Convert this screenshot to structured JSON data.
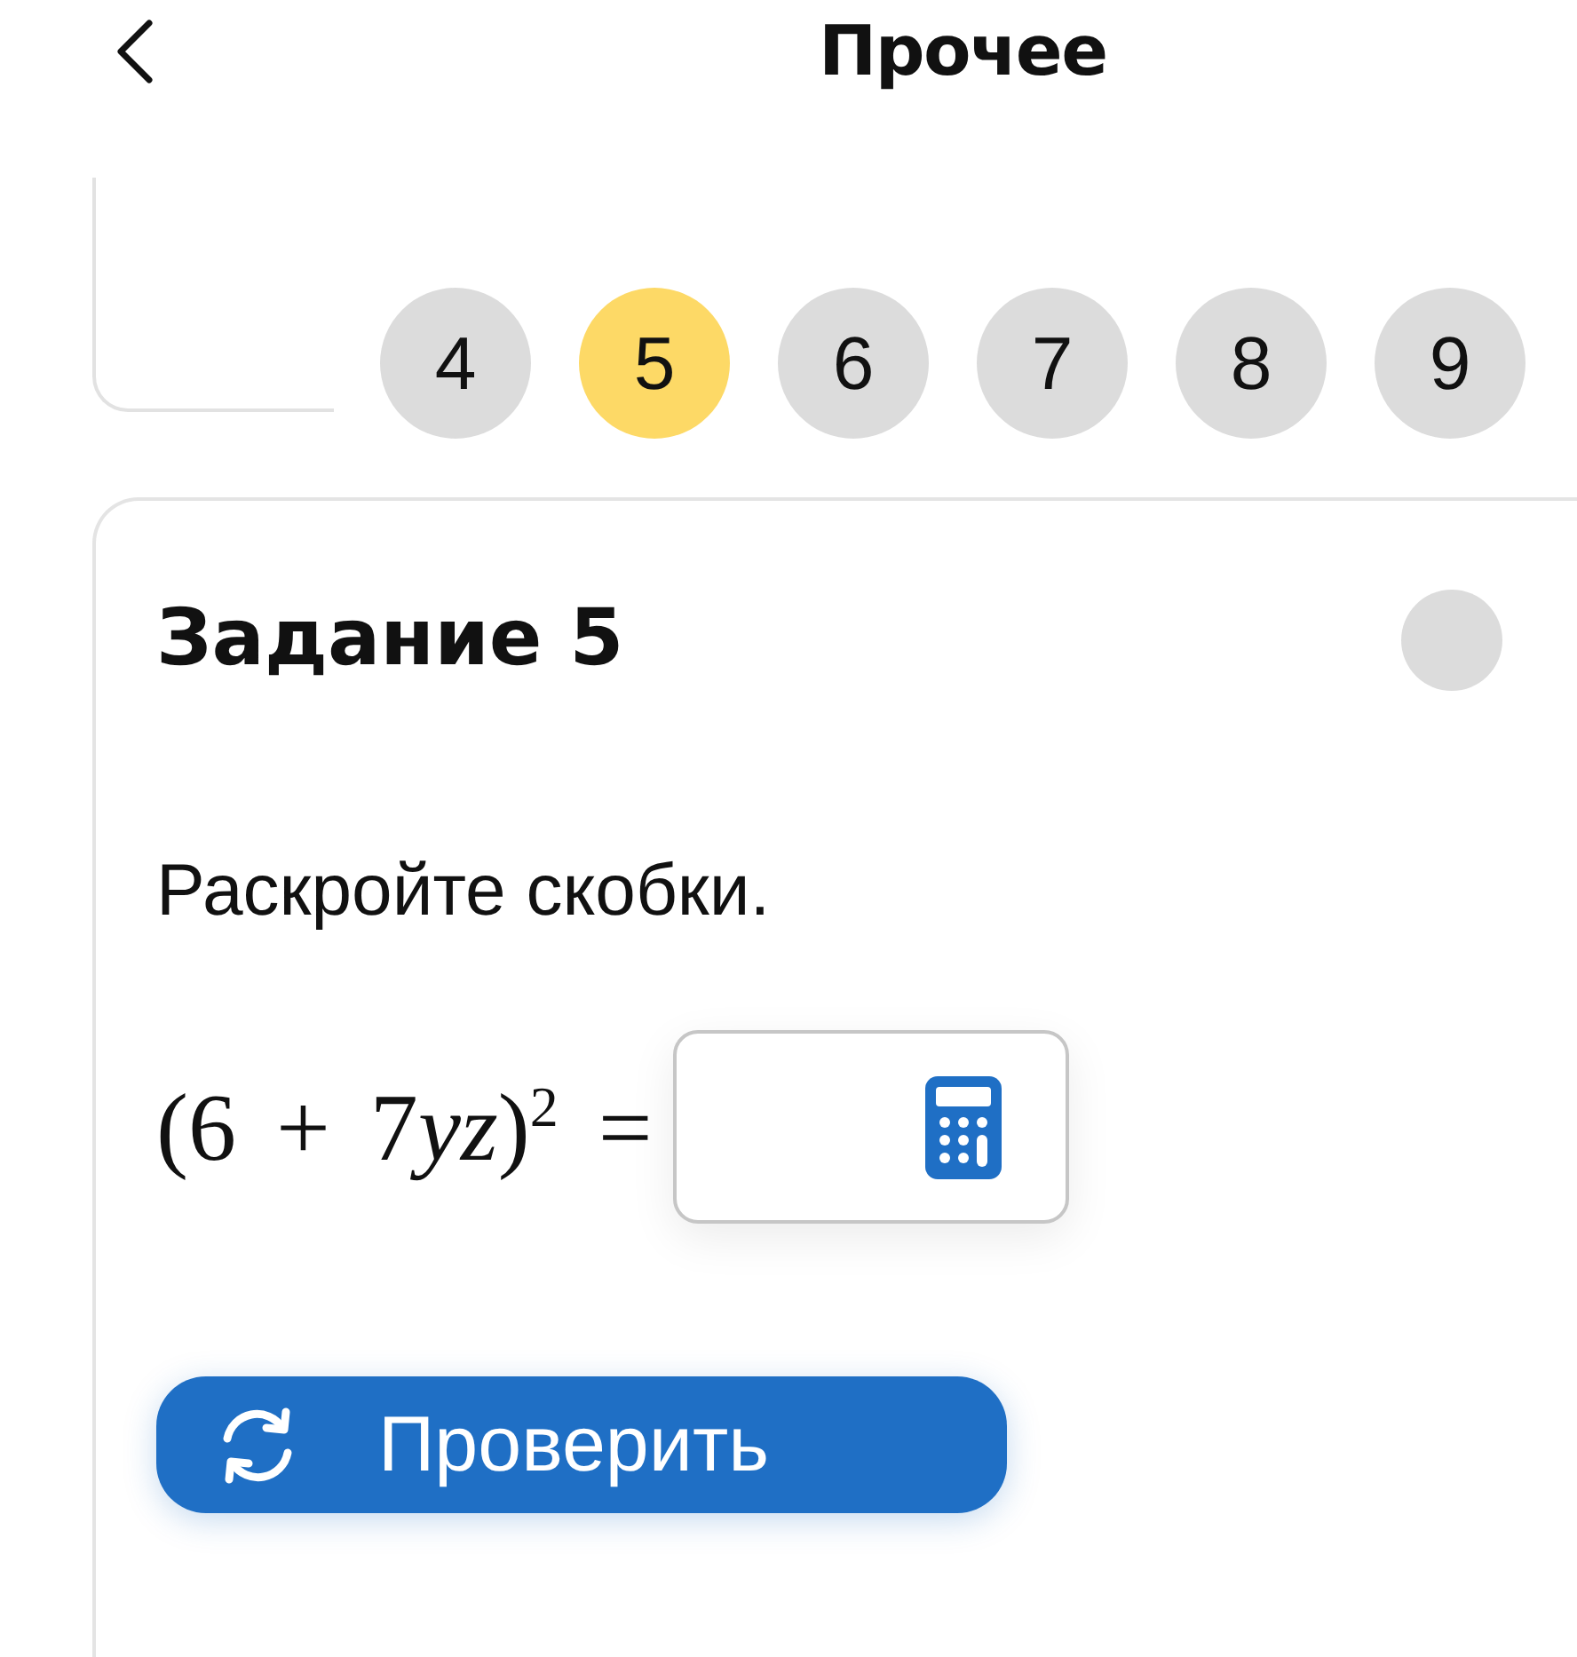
{
  "header": {
    "title": "Прочее"
  },
  "task_nav": {
    "items": [
      {
        "label": "4",
        "selected": false
      },
      {
        "label": "5",
        "selected": true
      },
      {
        "label": "6",
        "selected": false
      },
      {
        "label": "7",
        "selected": false
      },
      {
        "label": "8",
        "selected": false
      },
      {
        "label": "9",
        "selected": false
      }
    ]
  },
  "task": {
    "title": "Задание 5",
    "prompt": "Раскройте скобки.",
    "expression": [
      {
        "kind": "plain",
        "text": "(6 + 7"
      },
      {
        "kind": "variable",
        "text": "yz"
      },
      {
        "kind": "plain",
        "text": ")"
      },
      {
        "kind": "superscript",
        "text": "2"
      },
      {
        "kind": "plain",
        "text": " ="
      }
    ],
    "check_button": {
      "label": "Проверить"
    }
  }
}
